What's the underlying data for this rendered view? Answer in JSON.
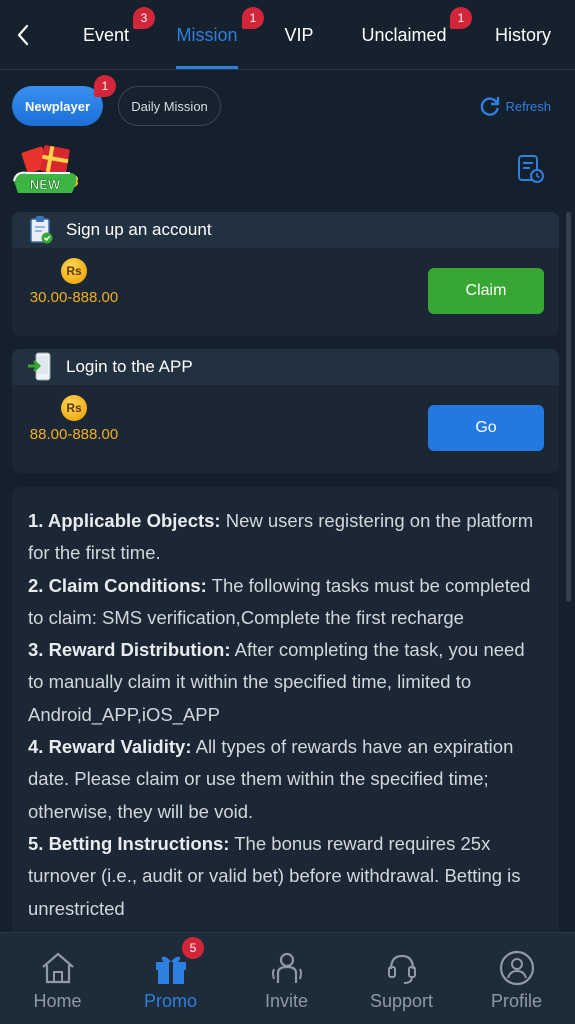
{
  "top_tabs": [
    {
      "label": "Event",
      "badge": "3"
    },
    {
      "label": "Mission",
      "badge": "1"
    },
    {
      "label": "VIP",
      "badge": ""
    },
    {
      "label": "Unclaimed",
      "badge": "1"
    },
    {
      "label": "History",
      "badge": ""
    }
  ],
  "active_tab": "Mission",
  "sub_tabs": {
    "newplayer": {
      "label": "Newplayer",
      "badge": "1"
    },
    "daily": {
      "label": "Daily Mission"
    }
  },
  "refresh_label": "Refresh",
  "new_logo_text": "NEW",
  "missions": [
    {
      "title": "Sign up an account",
      "currency": "Rs",
      "reward": "30.00-888.00",
      "action": "Claim",
      "action_color": "#37a632"
    },
    {
      "title": "Login to the APP",
      "currency": "Rs",
      "reward": "88.00-888.00",
      "action": "Go",
      "action_color": "#2479e0"
    }
  ],
  "rules": [
    {
      "head": "1. Applicable Objects:",
      "text": " New users registering on the platform for the first time."
    },
    {
      "head": "2. Claim Conditions:",
      "text": " The following tasks must be completed to claim: SMS verification,Complete the first recharge"
    },
    {
      "head": "3. Reward Distribution:",
      "text": " After completing the task, you need to manually claim it within the specified time, limited to Android_APP,iOS_APP"
    },
    {
      "head": "4. Reward Validity:",
      "text": " All types of rewards have an expiration date. Please claim or use them within the specified time; otherwise, they will be void."
    },
    {
      "head": "5. Betting Instructions:",
      "text": " The bonus reward requires 25x turnover (i.e., audit or valid bet) before withdrawal. Betting is unrestricted"
    }
  ],
  "bottom_nav": [
    {
      "label": "Home",
      "icon": "home-icon"
    },
    {
      "label": "Promo",
      "icon": "gift-icon",
      "badge": "5"
    },
    {
      "label": "Invite",
      "icon": "invite-icon"
    },
    {
      "label": "Support",
      "icon": "headset-icon"
    },
    {
      "label": "Profile",
      "icon": "profile-icon"
    }
  ],
  "active_nav": "Promo",
  "colors": {
    "accent": "#2e7fe0",
    "gold": "#f2b01e",
    "badge": "#d3263a",
    "background": "#14202c"
  }
}
